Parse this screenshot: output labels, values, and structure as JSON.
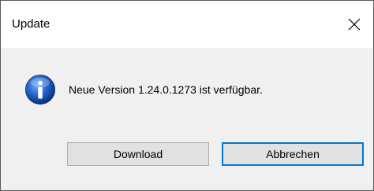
{
  "window": {
    "title": "Update"
  },
  "dialog": {
    "icon": "info-icon",
    "message": "Neue Version 1.24.0.1273 ist verfügbar."
  },
  "buttons": {
    "download_label": "Download",
    "cancel_label": "Abbrechen"
  },
  "colors": {
    "accent": "#0078d7",
    "icon_blue": "#1f5fbf"
  }
}
